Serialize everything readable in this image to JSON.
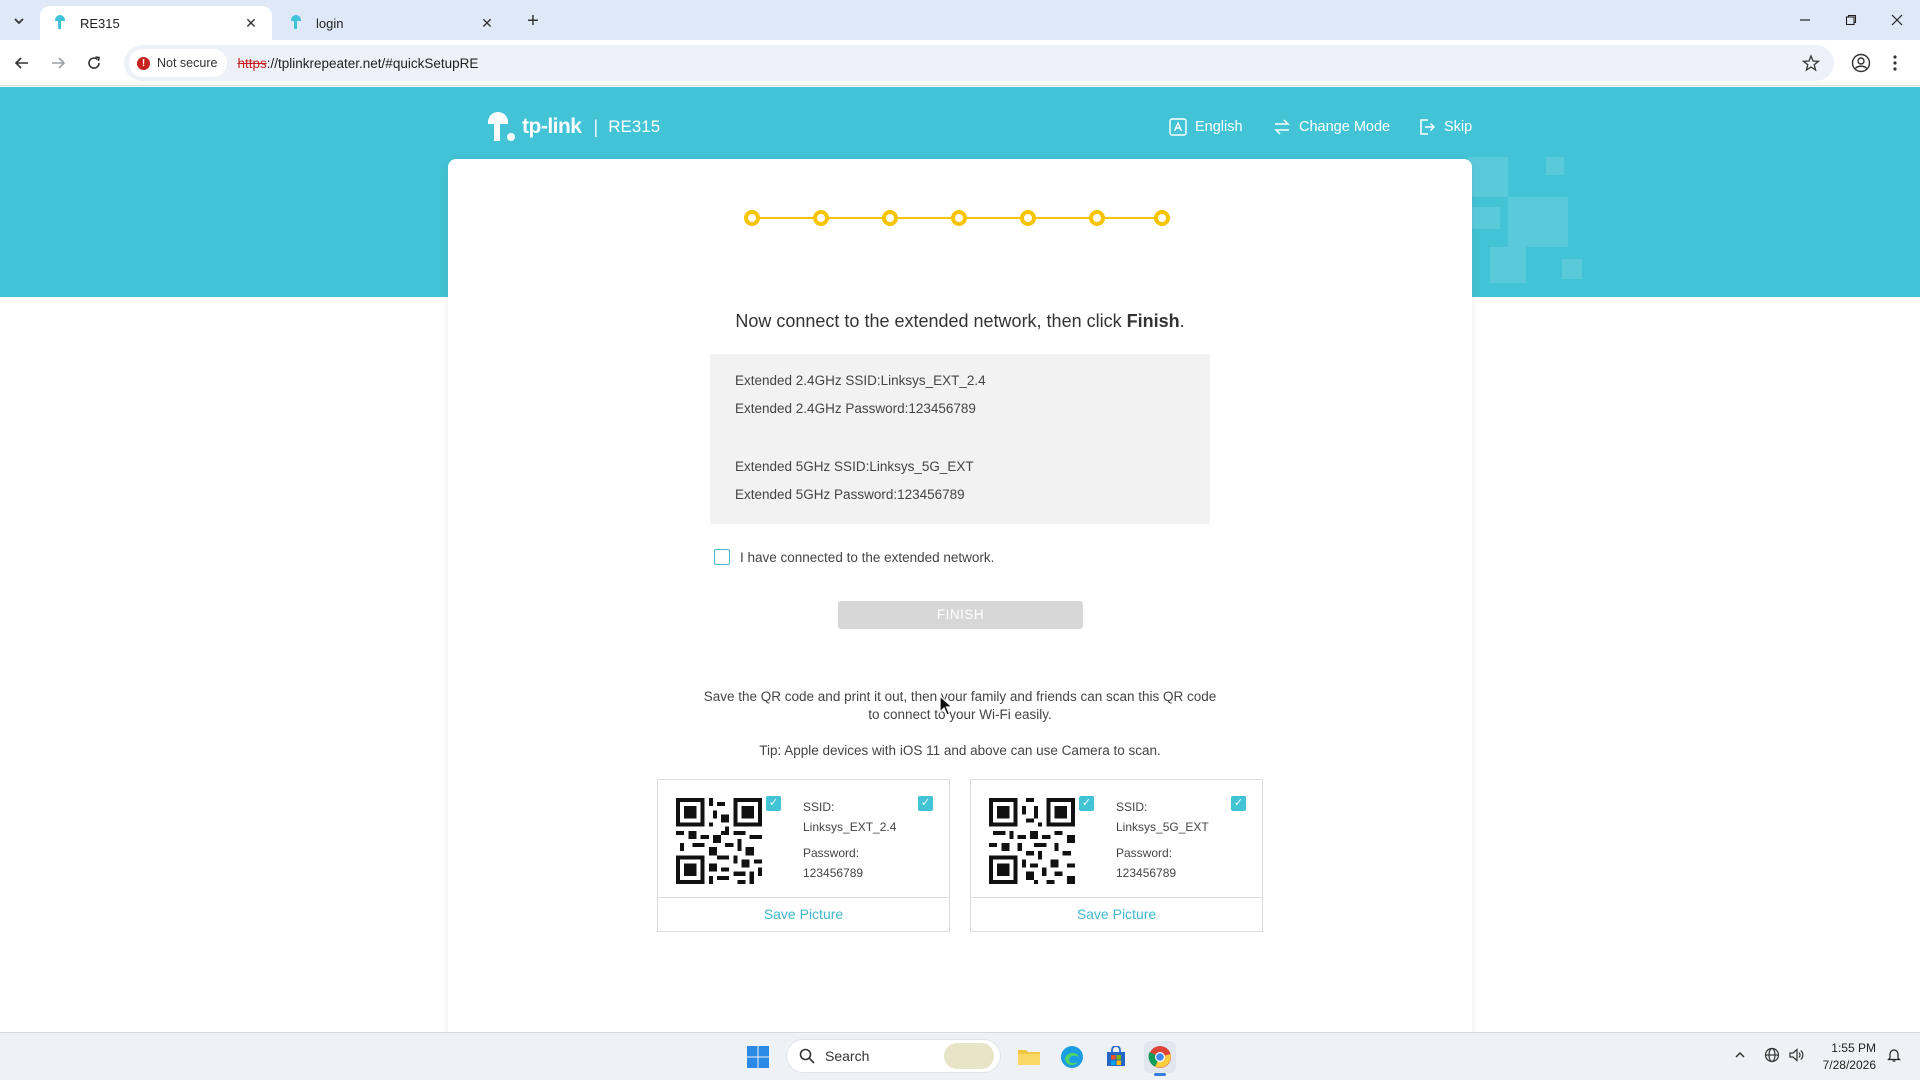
{
  "browser": {
    "tabs": [
      {
        "title": "RE315",
        "active": true
      },
      {
        "title": "login",
        "active": false
      }
    ],
    "security_label": "Not secure",
    "url_scheme": "https",
    "url_rest": "://tplinkrepeater.net/#quickSetupRE",
    "window_controls": [
      "minimize-icon",
      "restore-icon",
      "close-icon"
    ]
  },
  "header": {
    "logo_text": "tp-link",
    "separator": "|",
    "model": "RE315",
    "nav": [
      {
        "label": "English",
        "icon": "language-icon"
      },
      {
        "label": "Change Mode",
        "icon": "swap-icon"
      },
      {
        "label": "Skip",
        "icon": "skip-icon"
      }
    ]
  },
  "progress": {
    "steps_total": 7,
    "steps_completed": 7,
    "accent": "#f6c400"
  },
  "main": {
    "headline_prefix": "Now connect to the extended network, then click ",
    "headline_bold": "Finish",
    "headline_suffix": ".",
    "info": {
      "ssid_24": "Extended 2.4GHz SSID:Linksys_EXT_2.4",
      "pwd_24": "Extended 2.4GHz Password:123456789",
      "ssid_5": "Extended 5GHz SSID:Linksys_5G_EXT",
      "pwd_5": "Extended 5GHz Password:123456789"
    },
    "confirm_label": "I have connected to the extended network.",
    "confirm_checked": false,
    "finish_label": "FINISH",
    "qr_text": "Save the QR code and print it out, then your family and friends can scan this QR code to connect to your Wi-Fi easily.",
    "tip": "Tip: Apple devices with iOS 11 and above can use Camera to scan.",
    "qr_cards": [
      {
        "ssid_label": "SSID:",
        "ssid": "Linksys_EXT_2.4",
        "password_label": "Password:",
        "password": "123456789",
        "save_label": "Save Picture"
      },
      {
        "ssid_label": "SSID:",
        "ssid": "Linksys_5G_EXT",
        "password_label": "Password:",
        "password": "123456789",
        "save_label": "Save Picture"
      }
    ]
  },
  "colors": {
    "brand": "#42c3d6",
    "progress": "#f6c400",
    "link": "#42b7cc"
  },
  "taskbar": {
    "search_placeholder": "Search",
    "time": "1:55 PM",
    "date": "7/28/2026"
  }
}
